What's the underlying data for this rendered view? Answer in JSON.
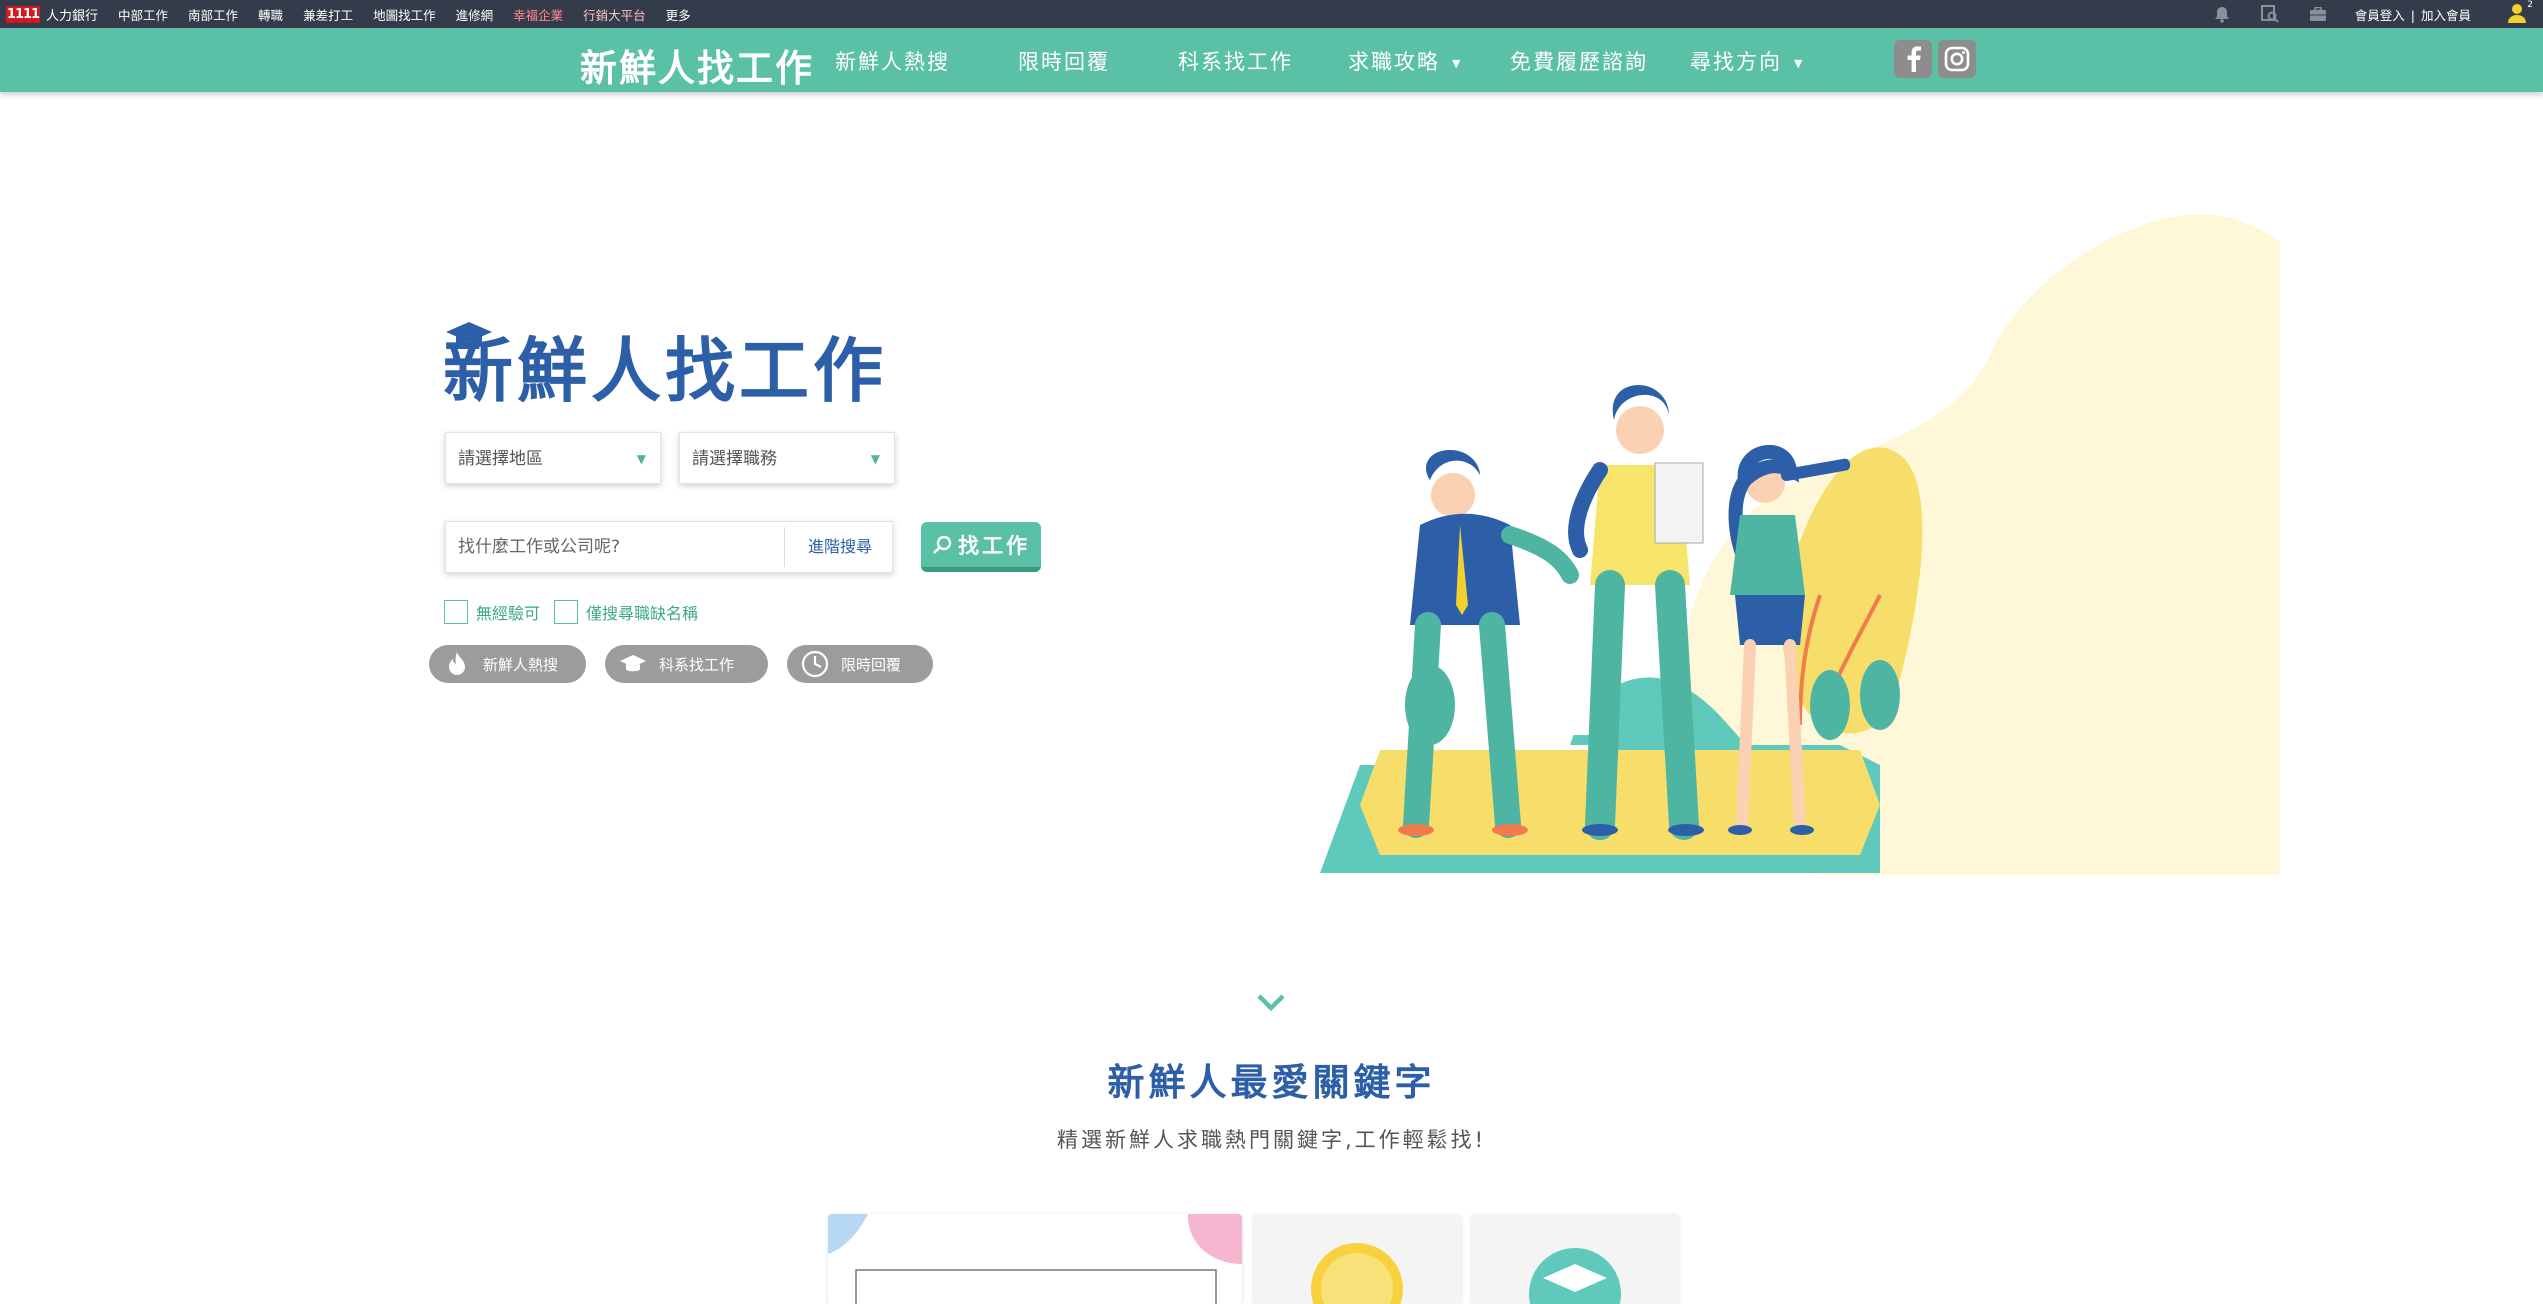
{
  "topbar": {
    "logo_mark": "1111",
    "brand": "人力銀行",
    "links": [
      "中部工作",
      "南部工作",
      "轉職",
      "兼差打工",
      "地圖找工作",
      "進修網",
      "幸福企業",
      "行銷大平台",
      "更多"
    ],
    "login": "會員登入",
    "join": "加入會員",
    "separator": "|",
    "user_badge": "2",
    "icons": [
      "bell-icon",
      "search-doc-icon",
      "briefcase-icon",
      "user-icon"
    ]
  },
  "nav": {
    "logo": "新鮮人找工作",
    "items": [
      "新鮮人熱搜",
      "限時回覆",
      "科系找工作",
      "求職攻略",
      "免費履歷諮詢",
      "尋找方向"
    ],
    "caret": "▼"
  },
  "hero": {
    "title": "新鮮人找工作",
    "area_placeholder": "請選擇地區",
    "job_placeholder": "請選擇職務",
    "search_placeholder": "找什麼工作或公司呢?",
    "advanced": "進階搜尋",
    "find_button": "找工作",
    "checkbox_no_exp": "無經驗可",
    "checkbox_title_only": "僅搜尋職缺名稱",
    "pills": [
      "新鮮人熱搜",
      "科系找工作",
      "限時回覆"
    ],
    "select_arrow": "▼"
  },
  "section": {
    "title": "新鮮人最愛關鍵字",
    "subtitle": "精選新鮮人求職熱門關鍵字,工作輕鬆找!"
  },
  "colors": {
    "topbar": "#343c4b",
    "nav": "#5bc1a6",
    "title_blue": "#2d5fa8",
    "accent_green": "#3aa889",
    "pill_gray": "#9c9c9c"
  }
}
